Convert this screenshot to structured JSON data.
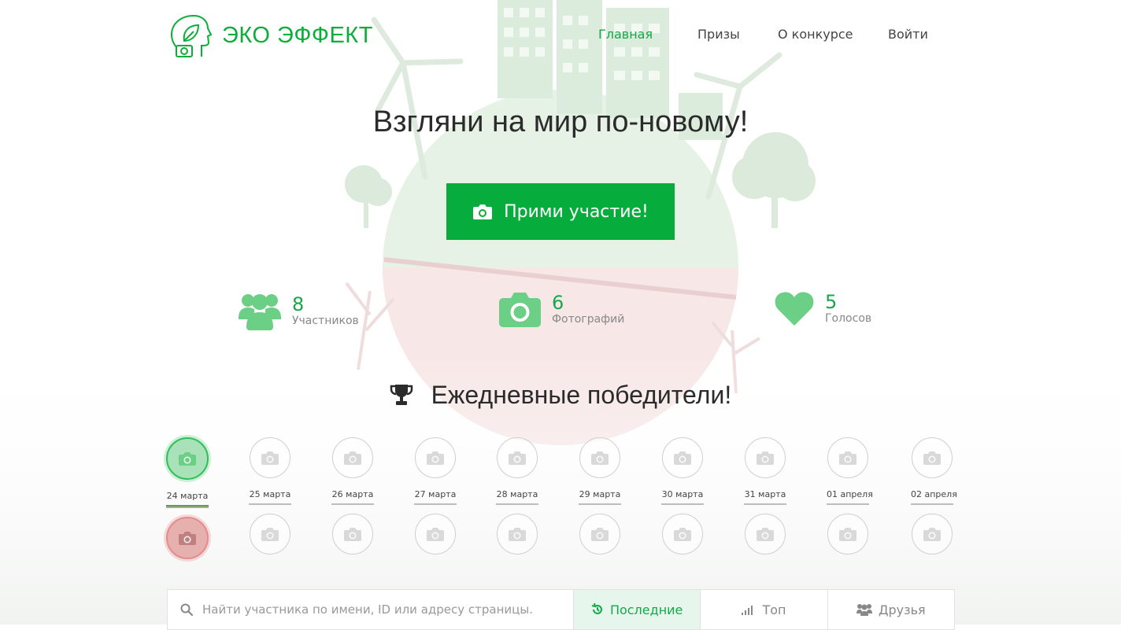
{
  "brand": {
    "name": "ЭКО ЭФФЕКТ"
  },
  "nav": [
    {
      "label": "Главная",
      "active": true
    },
    {
      "label": "Призы",
      "active": false
    },
    {
      "label": "О конкурсе",
      "active": false
    },
    {
      "label": "Войти",
      "active": false
    }
  ],
  "hero": {
    "title": "Взгляни на мир по-новому!",
    "cta_label": "Прими участие!"
  },
  "stats": [
    {
      "icon": "users-icon",
      "value": "8",
      "label": "Участников"
    },
    {
      "icon": "camera-icon",
      "value": "6",
      "label": "Фотографий"
    },
    {
      "icon": "heart-icon",
      "value": "5",
      "label": "Голосов"
    }
  ],
  "winners": {
    "title": "Ежедневные победители!",
    "days": [
      "24 марта",
      "25 марта",
      "26 марта",
      "27 марта",
      "28 марта",
      "29 марта",
      "30 марта",
      "31 марта",
      "01 апреля",
      "02 апреля"
    ]
  },
  "search": {
    "placeholder": "Найти участника по имени, ID или адресу страницы...",
    "tabs": [
      {
        "label": "Последние",
        "icon": "history-icon",
        "active": true
      },
      {
        "label": "Топ",
        "icon": "signal-bars-icon",
        "active": false
      },
      {
        "label": "Друзья",
        "icon": "users-icon",
        "active": false
      }
    ]
  },
  "colors": {
    "accent": "#07ad3c",
    "accent_light": "#6bcf86",
    "red_highlight": "#e19383"
  }
}
